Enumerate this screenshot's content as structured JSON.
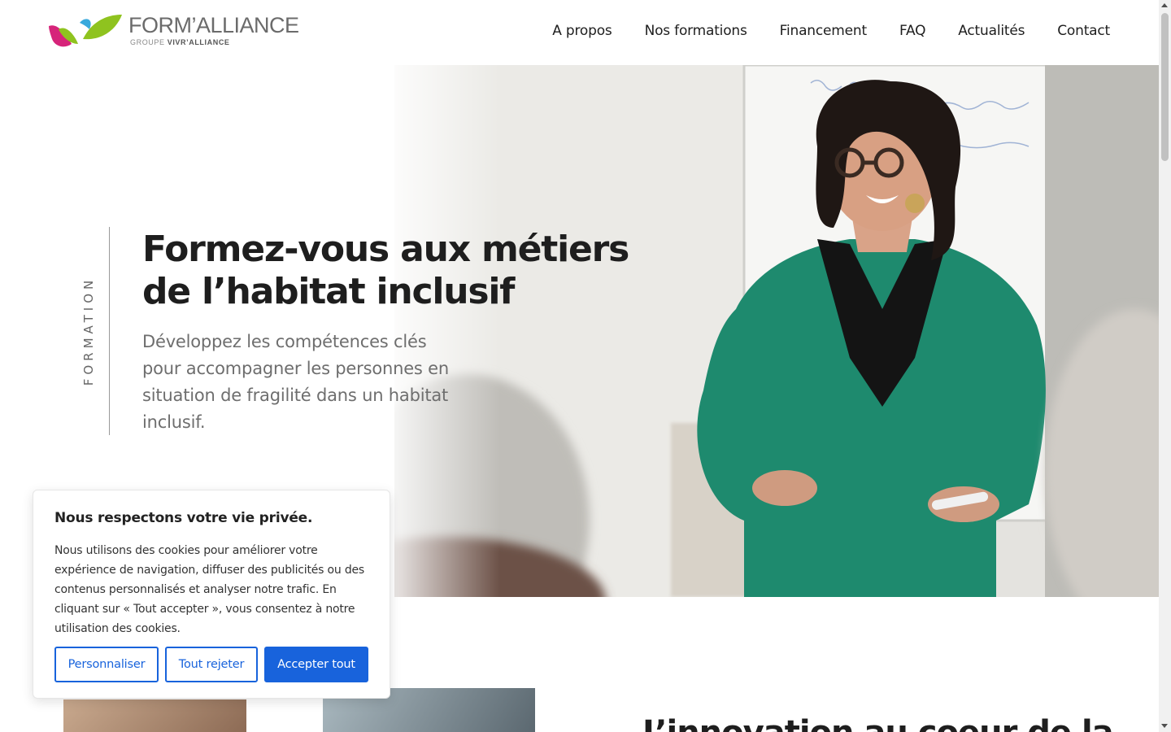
{
  "brand": {
    "name": "FORM’ALLIANCE",
    "sub_prefix": "GROUPE ",
    "sub_strong": "VIVR’ALLIANCE",
    "colors": {
      "green": "#8fc31f",
      "pink": "#d6247a",
      "blue": "#39a9dc"
    }
  },
  "nav": {
    "items": [
      {
        "label": "A propos"
      },
      {
        "label": "Nos formations"
      },
      {
        "label": "Financement"
      },
      {
        "label": "FAQ"
      },
      {
        "label": "Actualités"
      },
      {
        "label": "Contact"
      }
    ]
  },
  "hero": {
    "eyebrow": "FORMATION",
    "title_line1": "Formez-vous aux métiers",
    "title_line2": "de l’habitat inclusif",
    "subtitle": "Développez les compétences clés pour accompagner les personnes en situation de fragilité dans un habitat inclusif.",
    "photo_icon": "trainer-photo"
  },
  "section2": {
    "title_partial": "L’innovation au coeur de la"
  },
  "cookie": {
    "title": "Nous respectons votre vie privée.",
    "body": "Nous utilisons des cookies pour améliorer votre expérience de navigation, diffuser des publicités ou des contenus personnalisés et analyser notre trafic. En cliquant sur « Tout accepter », vous consentez à notre utilisation des cookies.",
    "customize_label": "Personnaliser",
    "reject_label": "Tout rejeter",
    "accept_label": "Accepter tout",
    "accent_color": "#1863dc"
  }
}
